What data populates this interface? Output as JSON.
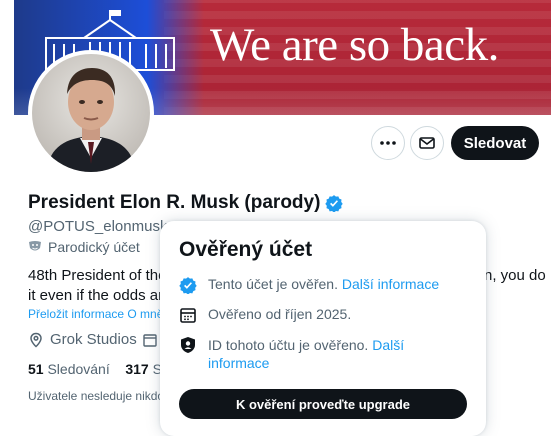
{
  "banner": {
    "text": "We are so back."
  },
  "actions": {
    "more_icon": "more-horizontal-icon",
    "mail_icon": "mail-icon",
    "follow_label": "Sledovat"
  },
  "profile": {
    "name": "President Elon R. Musk (parody)",
    "handle": "@POTUS_elonmusk_",
    "parody_label": "Parodický účet",
    "bio_line1": "48th President of the",
    "bio_line1_right": "n, you do",
    "bio_line2": "it even if the odds are",
    "translate_link": "Přeložit informace O mně",
    "location": "Grok Studios",
    "following_count": "51",
    "following_label": "Sledování",
    "followers_count": "317",
    "followers_label": "Sl",
    "not_following_text": "Uživatele nesleduje nikdo"
  },
  "popup": {
    "title": "Ověřený účet",
    "row1_text": "Tento účet je ověřen.",
    "row1_link": "Další informace",
    "row2_text": "Ověřeno od říjen 2025.",
    "row3_text": "ID tohoto účtu je ověřeno.",
    "row3_link": "Další informace",
    "button_label": "K ověření proveďte upgrade"
  },
  "colors": {
    "accent": "#1d9bf0",
    "primary_button": "#0f1419",
    "secondary_text": "#536471",
    "banner_red": "#b72a3a",
    "banner_blue": "#1e3a8a"
  }
}
